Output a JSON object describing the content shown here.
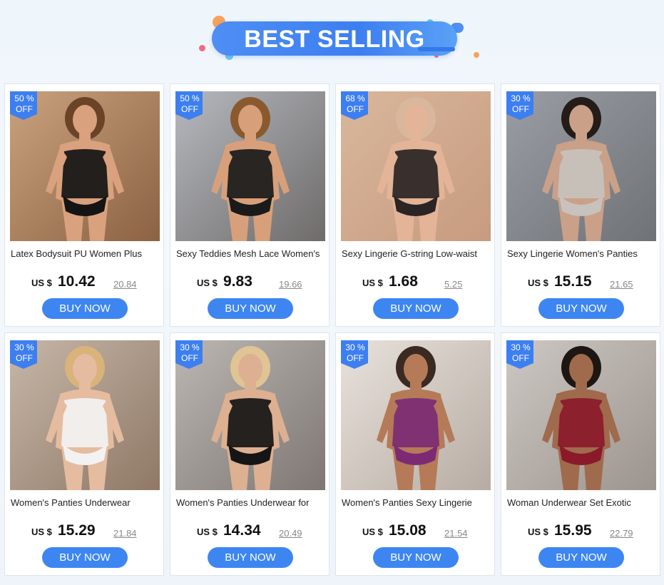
{
  "banner": {
    "title": "BEST SELLING"
  },
  "colors": {
    "accent": "#3d86f2",
    "badge": "#3d7ff0",
    "banner": "#4e8ef5"
  },
  "currency_label": "US $",
  "products": [
    {
      "discount": "50 %",
      "off": "OFF",
      "title": "Latex Bodysuit PU Women Plus",
      "price": "10.42",
      "old_price": "20.84",
      "button": "BUY NOW",
      "image": "black latex bodysuit photo"
    },
    {
      "discount": "50 %",
      "off": "OFF",
      "title": "Sexy Teddies Mesh Lace Women's",
      "price": "9.83",
      "old_price": "19.66",
      "button": "BUY NOW",
      "image": "black lace teddy photo"
    },
    {
      "discount": "68 %",
      "off": "OFF",
      "title": "Sexy Lingerie G-string Low-waist",
      "price": "1.68",
      "old_price": "5.25",
      "button": "BUY NOW",
      "image": "sheer black panty photo"
    },
    {
      "discount": "30 %",
      "off": "OFF",
      "title": "Sexy Lingerie Women's Panties",
      "price": "15.15",
      "old_price": "21.65",
      "button": "BUY NOW",
      "image": "grey lingerie set photo"
    },
    {
      "discount": "30 %",
      "off": "OFF",
      "title": "Women's Panties Underwear",
      "price": "15.29",
      "old_price": "21.84",
      "button": "BUY NOW",
      "image": "white lace set photo"
    },
    {
      "discount": "30 %",
      "off": "OFF",
      "title": "Women's Panties Underwear for",
      "price": "14.34",
      "old_price": "20.49",
      "button": "BUY NOW",
      "image": "black strappy set photo"
    },
    {
      "discount": "30 %",
      "off": "OFF",
      "title": "Women's Panties Sexy Lingerie",
      "price": "15.08",
      "old_price": "21.54",
      "button": "BUY NOW",
      "image": "purple lace set photo"
    },
    {
      "discount": "30 %",
      "off": "OFF",
      "title": "Woman Underwear Set Exotic",
      "price": "15.95",
      "old_price": "22.79",
      "button": "BUY NOW",
      "image": "red and black fringe set photo"
    }
  ]
}
